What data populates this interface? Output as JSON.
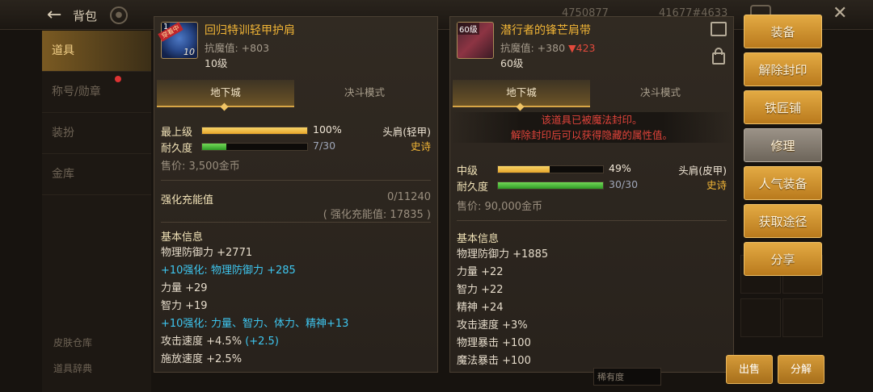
{
  "topbar": {
    "back_icon": "arrow-left-icon",
    "title": "背包",
    "currency1": "4750877",
    "currency2": "41677#4633"
  },
  "left_menu": {
    "items": [
      {
        "label": "道具",
        "active": true
      },
      {
        "label": "称号/勋章",
        "active": false
      },
      {
        "label": "装扮",
        "active": false
      },
      {
        "label": "金库",
        "active": false
      }
    ],
    "bottom1": "皮肤仓库",
    "bottom2": "道具辞典"
  },
  "left_item": {
    "name": "回归特训轻甲护肩",
    "icon_tag": "1",
    "icon_level": "10",
    "ribbon": "穿着中",
    "stat": "抗魔值: +803",
    "level": "10级",
    "tabs": [
      "地下城",
      "决斗模式"
    ],
    "bars": [
      {
        "label": "最上级",
        "value": "100%",
        "fill": 1.0,
        "color": "gold"
      },
      {
        "label": "耐久度",
        "value": "7/30",
        "fill": 0.23,
        "color": "green"
      }
    ],
    "slot": "头肩(轻甲)",
    "rarity": "史诗",
    "price": "售价: 3,500金币",
    "enh_label": "强化充能值",
    "enh_val": "0/11240",
    "enh_val2": "( 强化充能值: 17835 )",
    "basic_title": "基本信息",
    "stats": [
      {
        "text": "物理防御力 +2771",
        "blue": false,
        "extra": ""
      },
      {
        "text": "+10强化: 物理防御力 +285",
        "blue": true,
        "extra": ""
      },
      {
        "text": "力量 +29",
        "blue": false,
        "extra": ""
      },
      {
        "text": "智力 +19",
        "blue": false,
        "extra": ""
      },
      {
        "text": "+10强化: 力量、智力、体力、精神+13",
        "blue": true,
        "extra": ""
      },
      {
        "text": "攻击速度 +4.5% ",
        "blue": false,
        "extra": "(+2.5)"
      },
      {
        "text": "施放速度 +2.5%",
        "blue": false,
        "extra": ""
      }
    ]
  },
  "right_item": {
    "name": "潜行者的锋芒肩带",
    "icon_tag": "60级",
    "stat": "抗魔值: +380",
    "stat_down": "▼423",
    "level": "60级",
    "tabs": [
      "地下城",
      "决斗模式"
    ],
    "seal_line1": "该道具已被魔法封印。",
    "seal_line2": "解除封印后可以获得隐藏的属性值。",
    "bars": [
      {
        "label": "中级",
        "value": "49%",
        "fill": 0.49,
        "color": "gold"
      },
      {
        "label": "耐久度",
        "value": "30/30",
        "fill": 1.0,
        "color": "green"
      }
    ],
    "slot": "头肩(皮甲)",
    "rarity": "史诗",
    "price": "售价: 90,000金币",
    "basic_title": "基本信息",
    "stats": [
      "物理防御力 +1885",
      "力量 +22",
      "智力 +22",
      "精神 +24",
      "攻击速度 +3%",
      "物理暴击 +100",
      "魔法暴击 +100"
    ]
  },
  "side_buttons": [
    "装备",
    "解除封印",
    "铁匠铺",
    "修理",
    "人气装备",
    "获取途径",
    "分享"
  ],
  "bottom": {
    "sort": "稀有度",
    "sell": "出售",
    "decompose": "分解"
  }
}
